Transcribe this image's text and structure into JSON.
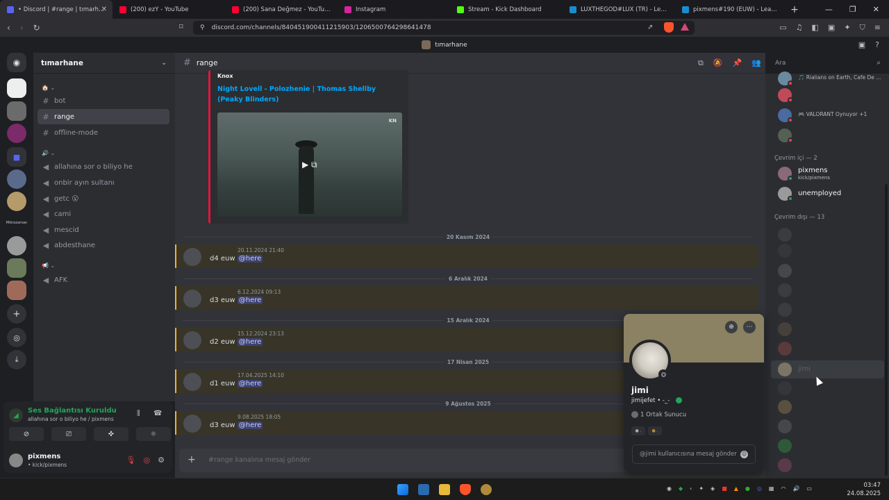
{
  "browser": {
    "tabs": [
      {
        "title": "• Discord | #range | tımarhane",
        "color": "#5865f2",
        "active": true
      },
      {
        "title": "(200) ezY - YouTube",
        "color": "#ff0033"
      },
      {
        "title": "(200) Sana Değmez - YouTube",
        "color": "#ff0033"
      },
      {
        "title": "Instagram",
        "color": "#d6249f"
      },
      {
        "title": "Stream - Kick Dashboard",
        "color": "#53fc18"
      },
      {
        "title": "LUXTHEGOD#LUX (TR) - LeagueOfGraphs",
        "color": "#1a8dd0"
      },
      {
        "title": "pixmens#190 (EUW) - LeagueOfGraphs",
        "color": "#1a8dd0"
      }
    ],
    "url": "discord.com/channels/840451900411215903/1206500764298641478"
  },
  "discord": {
    "window_title": "tımarhane",
    "server_name": "tımarhane",
    "channels": [
      {
        "kind": "category",
        "label": "🏠 ⌄"
      },
      {
        "kind": "text",
        "label": "bot"
      },
      {
        "kind": "text",
        "label": "range",
        "selected": true
      },
      {
        "kind": "text",
        "label": "offline-mode"
      },
      {
        "kind": "category",
        "label": "🔊 ⌄"
      },
      {
        "kind": "voice",
        "label": "allahına sor o biliyo he"
      },
      {
        "kind": "voice",
        "label": "onbir ayın sultanı"
      },
      {
        "kind": "voice",
        "label": "getc 😮"
      },
      {
        "kind": "voice",
        "label": "cami"
      },
      {
        "kind": "voice",
        "label": "mescid"
      },
      {
        "kind": "voice",
        "label": "abdesthane"
      },
      {
        "kind": "category",
        "label": "📢 ⌄"
      },
      {
        "kind": "voice",
        "label": "AFK"
      }
    ],
    "guild_label": "Mikrozaman",
    "voice": {
      "title": "Ses Bağlantısı Kuruldu",
      "channel": "allahına sor o biliyo he / pixmens"
    },
    "user": {
      "name": "pixmens",
      "status": "• kick/pixmens"
    },
    "channel_header": "range",
    "embed": {
      "author": "Knox",
      "title": "Night Lovell - Polozhenie | Thomas Shellby (Peaky Blinders)",
      "watermark": "KN"
    },
    "messages": [
      {
        "date": "20 Kasım 2024",
        "time": "20.11.2024 21:40",
        "text": "d4 euw",
        "mention": "@here"
      },
      {
        "date": "6 Aralık 2024",
        "time": "6.12.2024 09:13",
        "text": "d3 euw",
        "mention": "@here"
      },
      {
        "date": "15 Aralık 2024",
        "time": "15.12.2024 23:13",
        "text": "d2 euw",
        "mention": "@here"
      },
      {
        "date": "17 Nisan 2025",
        "time": "17.04.2025 14:10",
        "text": "d1 euw",
        "mention": "@here"
      },
      {
        "date": "9 Ağustos 2025",
        "time": "9.08.2025 18:05",
        "text": "d3 euw",
        "mention": "@here"
      }
    ],
    "composer_placeholder": "#range kanalına mesaj gönder",
    "search_placeholder": "Ara",
    "members": {
      "top": [
        {
          "activity": "🎵 Rialians on Earth, Cafe De ..."
        },
        {
          "activity": ""
        },
        {
          "activity": "🎮 VALORANT Oynuyor +1"
        },
        {
          "activity": ""
        }
      ],
      "online_header": "Çevrim içi — 2",
      "online": [
        {
          "name": "pixmens",
          "sub": "kick/pixmens"
        },
        {
          "name": "unemployed",
          "sub": ""
        }
      ],
      "offline_header": "Çevrim dışı — 13",
      "offline_hover_name": "jimi"
    },
    "popout": {
      "name": "jimi",
      "handle": "jimijefet • -_-",
      "mutual": "1 Ortak Sunucu",
      "message_placeholder": "@jimi kullanıcısına mesaj gönder"
    }
  },
  "taskbar": {
    "time": "03:47",
    "date": "24.08.2025"
  }
}
